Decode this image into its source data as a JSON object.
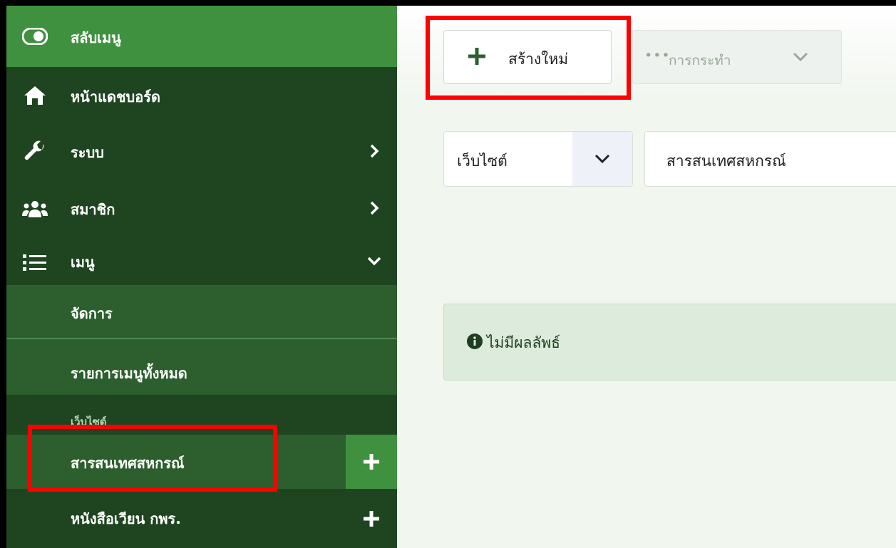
{
  "sidebar": {
    "toggle_label": "สลับเมนู",
    "items": [
      {
        "label": "หน้าแดชบอร์ด",
        "icon": "home-icon"
      },
      {
        "label": "ระบบ",
        "icon": "wrench-icon"
      },
      {
        "label": "สมาชิก",
        "icon": "users-icon"
      },
      {
        "label": "เมนู",
        "icon": "list-icon"
      }
    ],
    "submenu": [
      {
        "label": "จัดการ"
      },
      {
        "label": "รายการเมนูทั้งหมด"
      }
    ],
    "section_heading": "เว็บไซต์",
    "sites": [
      {
        "label": "สารสนเทศสหกรณ์"
      },
      {
        "label": "หนังสือเวียน กพร."
      }
    ]
  },
  "toolbar": {
    "new_label": "สร้างใหม่",
    "actions_label": "การกระทำ"
  },
  "filters": {
    "site_label": "เว็บไซต์",
    "site_value": "สารสนเทศสหกรณ์"
  },
  "result": {
    "message": "ไม่มีผลลัพธ์"
  },
  "colors": {
    "sidebar": "#2c5f2d",
    "sidebar_dark": "#1f4520",
    "accent": "#3f9140",
    "highlight": "#ff0000"
  }
}
